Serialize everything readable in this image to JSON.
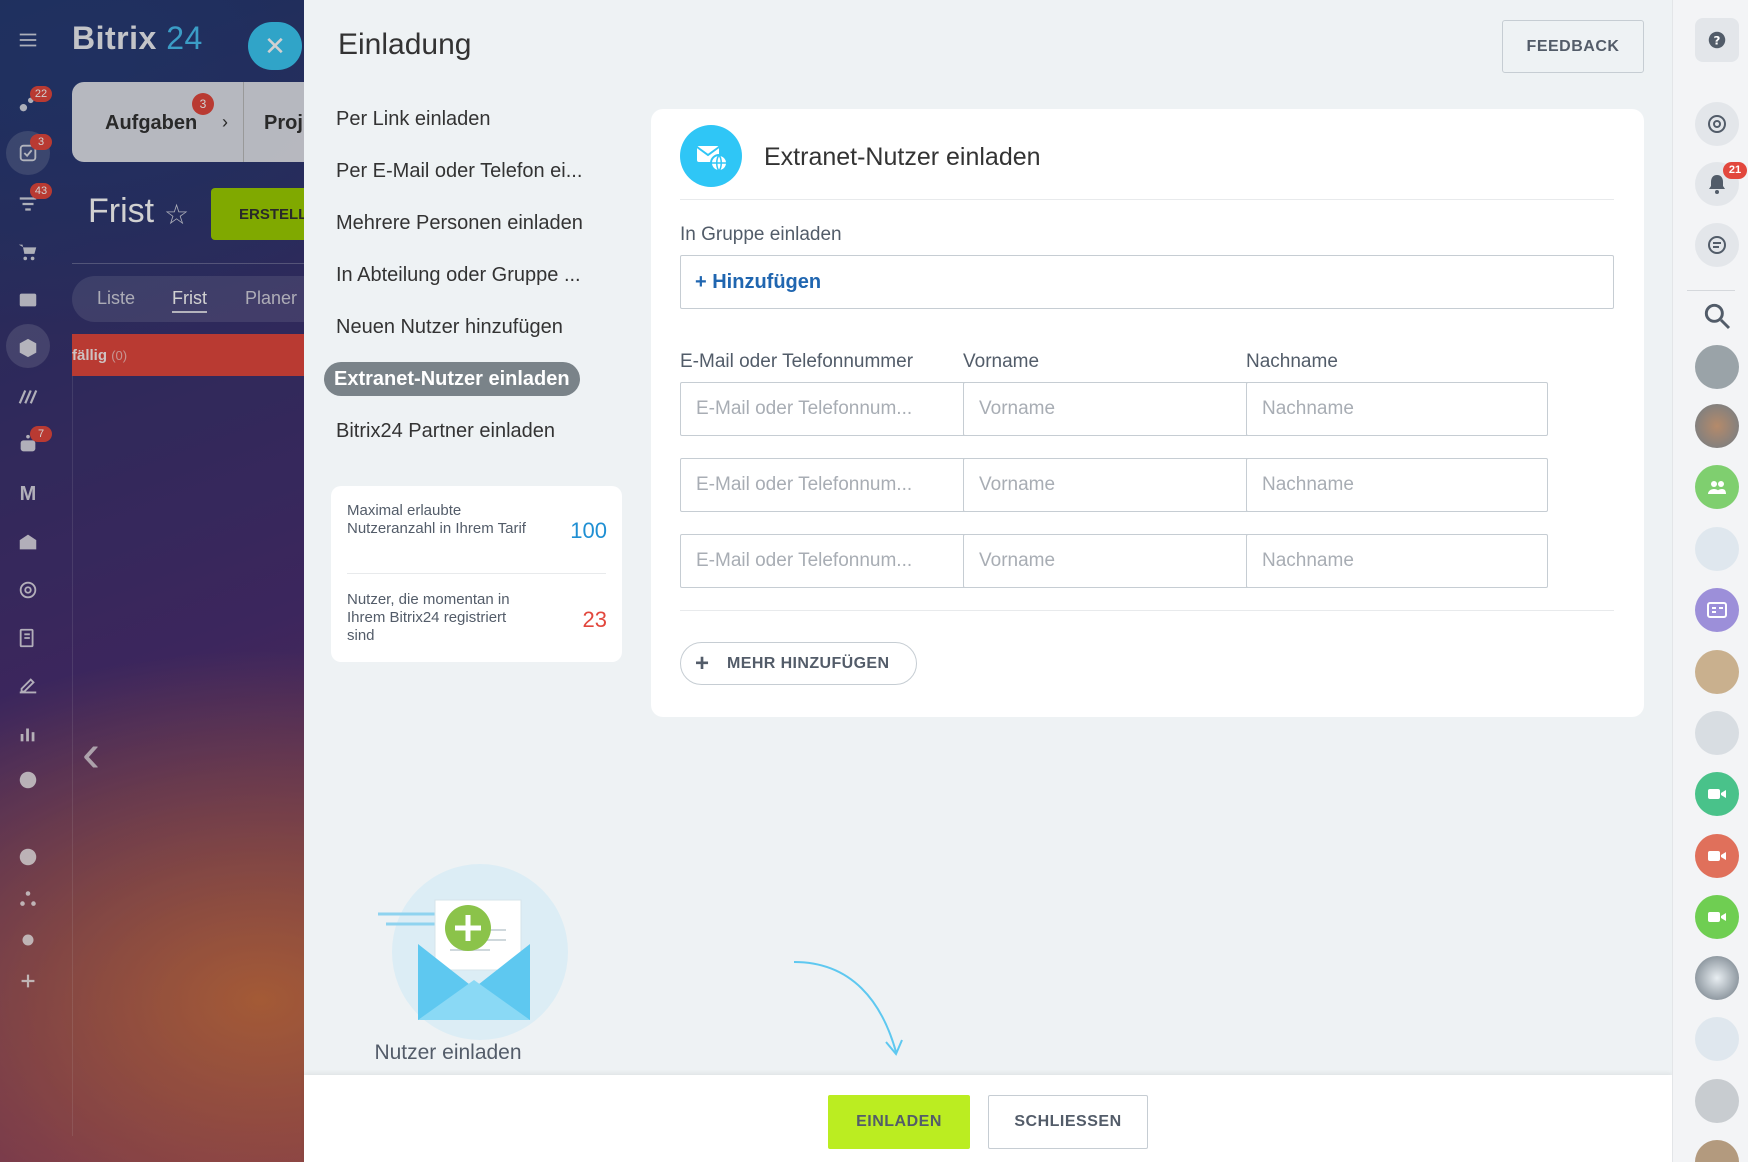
{
  "background_app": {
    "brand": "Bitrix",
    "brand_num": "24",
    "nav_badges": [
      "22",
      "3",
      "43",
      "7"
    ],
    "nav_letter": "M",
    "tab_tasks": "Aufgaben",
    "tab_tasks_badge": "3",
    "tab_projects": "Proj",
    "view_title": "Frist",
    "create_button": "ERSTELL",
    "views": [
      "Liste",
      "Frist",
      "Planer"
    ],
    "overdue_label": "fällig",
    "overdue_count": "(0)"
  },
  "panel": {
    "title": "Einladung",
    "feedback_label": "FEEDBACK"
  },
  "invite_menu": {
    "items": [
      {
        "label": "Per Link einladen",
        "active": false
      },
      {
        "label": "Per E-Mail oder Telefon ei...",
        "active": false
      },
      {
        "label": "Mehrere Personen einladen",
        "active": false
      },
      {
        "label": "In Abteilung oder Gruppe ...",
        "active": false
      },
      {
        "label": "Neuen Nutzer hinzufügen",
        "active": false
      },
      {
        "label": "Extranet-Nutzer einladen",
        "active": true
      },
      {
        "label": "Bitrix24 Partner einladen",
        "active": false
      }
    ]
  },
  "limits": {
    "max_label": "Maximal erlaubte Nutzeranzahl in Ihrem Tarif",
    "max_value": "100",
    "max_color": "#1f8fd3",
    "current_label": "Nutzer, die momentan in Ihrem Bitrix24 registriert sind",
    "current_value": "23",
    "current_color": "#e2473d"
  },
  "illustration": {
    "label": "Nutzer einladen"
  },
  "card": {
    "title": "Extranet-Nutzer einladen",
    "group_label": "In Gruppe einladen",
    "group_add": "+ Hinzufügen",
    "columns": {
      "contact": "E-Mail oder Telefonnummer",
      "first_name": "Vorname",
      "last_name": "Nachname"
    },
    "rows": [
      {
        "contact_placeholder": "E-Mail oder Telefonnum...",
        "first_placeholder": "Vorname",
        "last_placeholder": "Nachname"
      },
      {
        "contact_placeholder": "E-Mail oder Telefonnum...",
        "first_placeholder": "Vorname",
        "last_placeholder": "Nachname"
      },
      {
        "contact_placeholder": "E-Mail oder Telefonnum...",
        "first_placeholder": "Vorname",
        "last_placeholder": "Nachname"
      }
    ],
    "more_label": "MEHR HINZUFÜGEN"
  },
  "footer": {
    "invite_label": "EINLADEN",
    "close_label": "SCHLIESSEN"
  },
  "right_rail": {
    "notification_badge": "21",
    "icons": [
      "help-icon",
      "copilot-icon",
      "bell-icon",
      "chat-icon",
      "search-icon"
    ]
  },
  "colors": {
    "accent_blue": "#2fc6f6",
    "invite_green": "#bbed21",
    "link_blue": "#2066b0",
    "active_menu_bg": "#7a8389"
  }
}
